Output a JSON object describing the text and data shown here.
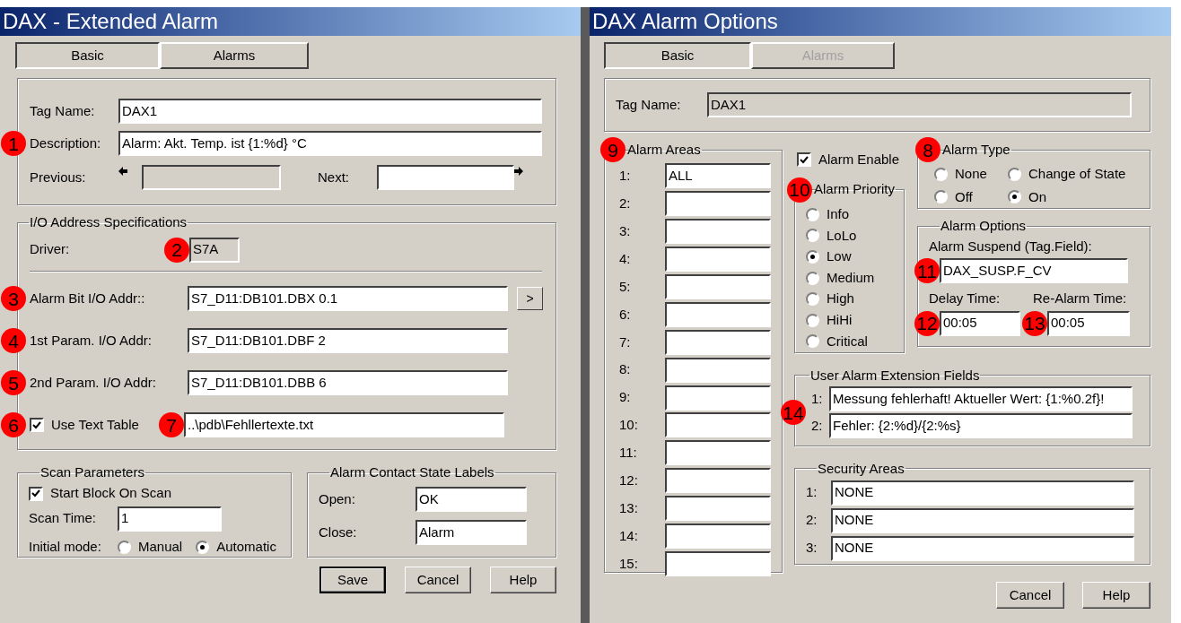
{
  "left": {
    "title": "DAX - Extended Alarm",
    "tabs": [
      {
        "label": "Basic",
        "selected": true
      },
      {
        "label": "Alarms",
        "selected": false
      }
    ],
    "tag_name": {
      "label": "Tag Name:",
      "value": "DAX1"
    },
    "description": {
      "marker": "1",
      "label": "Description:",
      "value": "Alarm: Akt. Temp. ist {1:%d} °C"
    },
    "previous": {
      "label": "Previous:",
      "disabled": true
    },
    "next": {
      "label": "Next:",
      "disabled": false
    },
    "io": {
      "title": "I/O Address Specifications",
      "driver": {
        "label": "Driver:",
        "marker": "2",
        "value": "S7A"
      },
      "rows": [
        {
          "marker": "3",
          "label": "Alarm Bit I/O Addr::",
          "value": "S7_D11:DB101.DBX 0.1",
          "browse": ">"
        },
        {
          "marker": "4",
          "label": "1st Param. I/O Addr:",
          "value": "S7_D11:DB101.DBF 2"
        },
        {
          "marker": "5",
          "label": "2nd Param. I/O Addr:",
          "value": "S7_D11:DB101.DBB 6"
        }
      ],
      "text_table": {
        "marker": "6",
        "label": "Use Text Table",
        "checked": true,
        "file_marker": "7",
        "file": "..\\pdb\\Fehllertexte.txt"
      }
    },
    "scan": {
      "title": "Scan Parameters",
      "start_block": {
        "label": "Start Block On Scan",
        "checked": true
      },
      "scan_time": {
        "label": "Scan Time:",
        "value": "1"
      },
      "initial_mode": {
        "label": "Initial mode:",
        "options": [
          {
            "label": "Manual",
            "selected": false
          },
          {
            "label": "Automatic",
            "selected": true
          }
        ]
      }
    },
    "contact": {
      "title": "Alarm Contact State Labels",
      "rows": [
        {
          "label": "Open:",
          "value": "OK"
        },
        {
          "label": "Close:",
          "value": "Alarm"
        }
      ]
    },
    "buttons": [
      {
        "label": "Save",
        "default": true
      },
      {
        "label": "Cancel",
        "default": false
      },
      {
        "label": "Help",
        "default": false
      }
    ]
  },
  "right": {
    "title": "DAX Alarm Options",
    "tabs": [
      {
        "label": "Basic",
        "selected": true,
        "disabled": false
      },
      {
        "label": "Alarms",
        "selected": false,
        "disabled": true
      }
    ],
    "tag_name": {
      "label": "Tag Name:",
      "value": "DAX1",
      "disabled": true
    },
    "alarm_areas": {
      "marker": "9",
      "title": "Alarm Areas",
      "rows": [
        {
          "label": "1:",
          "value": "ALL"
        },
        {
          "label": "2:"
        },
        {
          "label": "3:"
        },
        {
          "label": "4:"
        },
        {
          "label": "5:"
        },
        {
          "label": "6:"
        },
        {
          "label": "7:"
        },
        {
          "label": "8:"
        },
        {
          "label": "9:"
        },
        {
          "label": "10:"
        },
        {
          "label": "11:"
        },
        {
          "label": "12:"
        },
        {
          "label": "13:"
        },
        {
          "label": "14:"
        },
        {
          "label": "15:"
        }
      ]
    },
    "alarm_enable": {
      "label": "Alarm Enable",
      "checked": true
    },
    "alarm_priority": {
      "marker": "10",
      "title": "Alarm Priority",
      "options": [
        {
          "label": "Info",
          "selected": false
        },
        {
          "label": "LoLo",
          "selected": false
        },
        {
          "label": "Low",
          "selected": true
        },
        {
          "label": "Medium",
          "selected": false
        },
        {
          "label": "High",
          "selected": false
        },
        {
          "label": "HiHi",
          "selected": false
        },
        {
          "label": "Critical",
          "selected": false
        }
      ]
    },
    "alarm_type": {
      "marker": "8",
      "title": "Alarm Type",
      "options": [
        {
          "label": "None",
          "selected": false
        },
        {
          "label": "Change of State",
          "selected": false
        },
        {
          "label": "Off",
          "selected": false
        },
        {
          "label": "On",
          "selected": true
        }
      ]
    },
    "alarm_options": {
      "title": "Alarm Options",
      "suspend": {
        "label": "Alarm Suspend (Tag.Field):",
        "marker": "11",
        "value": "DAX_SUSP.F_CV"
      },
      "delay": {
        "label": "Delay Time:",
        "marker": "12",
        "value": "00:05"
      },
      "realarm": {
        "label": "Re-Alarm Time:",
        "marker": "13",
        "value": "00:05"
      }
    },
    "extension": {
      "title": "User Alarm Extension Fields",
      "marker": "14",
      "rows": [
        {
          "label": "1:",
          "value": "Messung fehlerhaft! Aktueller Wert: {1:%0.2f}!"
        },
        {
          "label": "2:",
          "value": "Fehler: {2:%d}/{2:%s}"
        }
      ]
    },
    "security": {
      "title": "Security Areas",
      "rows": [
        {
          "label": "1:",
          "value": "NONE"
        },
        {
          "label": "2:",
          "value": "NONE"
        },
        {
          "label": "3:",
          "value": "NONE"
        }
      ]
    },
    "buttons": [
      {
        "label": "Cancel",
        "default": false
      },
      {
        "label": "Help",
        "default": false
      }
    ]
  }
}
